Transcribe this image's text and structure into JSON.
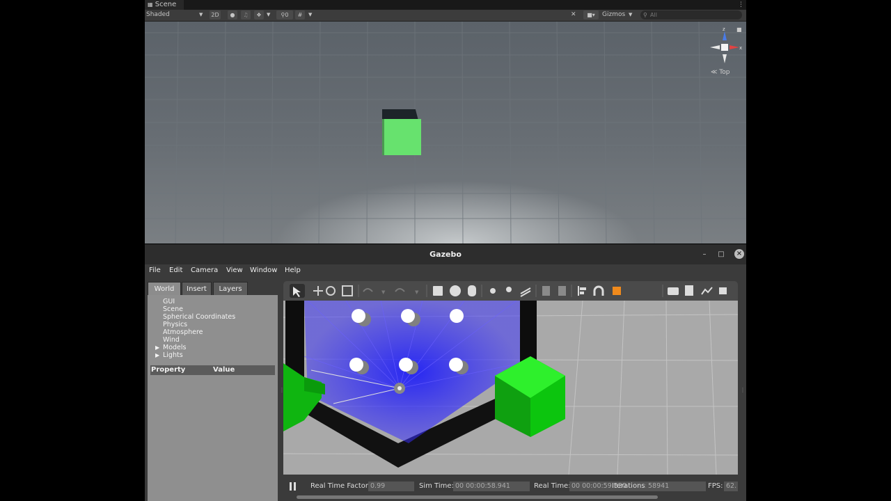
{
  "unity": {
    "tab_label": "Scene",
    "shading_mode": "Shaded",
    "mode_2d": "2D",
    "hidden_count": "0",
    "gizmos_label": "Gizmos",
    "search_placeholder": "All",
    "view_label": "Top",
    "axis_labels": {
      "y": "z",
      "x": "x"
    },
    "cube_color": "#67e26e"
  },
  "gazebo": {
    "title": "Gazebo",
    "menu": [
      "File",
      "Edit",
      "Camera",
      "View",
      "Window",
      "Help"
    ],
    "tabs": [
      "World",
      "Insert",
      "Layers"
    ],
    "tree": [
      "GUI",
      "Scene",
      "Spherical Coordinates",
      "Physics",
      "Atmosphere",
      "Wind",
      "Models",
      "Lights"
    ],
    "property_header": "Property",
    "value_header": "Value",
    "status": {
      "rtf_label": "Real Time Factor:",
      "rtf_value": "0.99",
      "sim_label": "Sim Time:",
      "sim_value": "00 00:00:58.941",
      "real_label": "Real Time:",
      "real_value": "00 00:00:59.320",
      "iter_label": "Iterations:",
      "iter_value": "58941",
      "fps_label": "FPS:",
      "fps_value": "62."
    },
    "colors": {
      "laser": "#1e10f0",
      "box": "#0fd010",
      "accent": "#f08a1c"
    }
  }
}
